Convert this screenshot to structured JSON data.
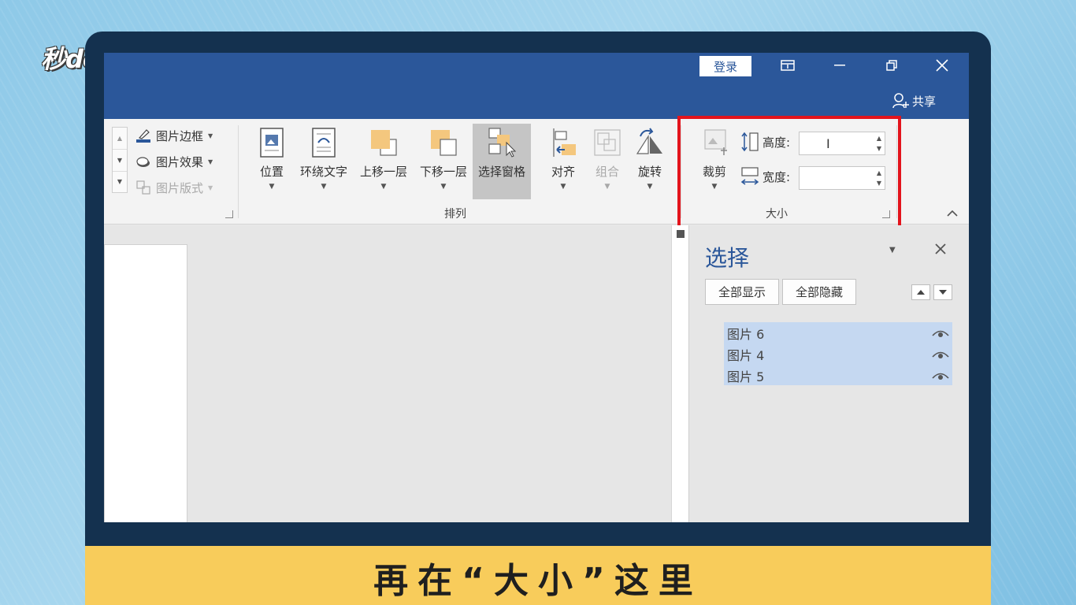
{
  "logo": "秒dòng视频",
  "caption": "再在“大小”这里",
  "window": {
    "login_label": "登录",
    "share_label": "共享"
  },
  "ribbon": {
    "picture_styles": {
      "border_label": "图片边框",
      "effects_label": "图片效果",
      "layout_label": "图片版式"
    },
    "arrange": {
      "group_label": "排列",
      "position_label": "位置",
      "wrap_text_label": "环绕文字",
      "bring_forward_label": "上移一层",
      "send_backward_label": "下移一层",
      "selection_pane_label": "选择窗格",
      "align_label": "对齐",
      "group_btn_label": "组合",
      "rotate_label": "旋转"
    },
    "size": {
      "group_label": "大小",
      "crop_label": "裁剪",
      "height_label": "高度:",
      "width_label": "宽度:",
      "height_value": "",
      "width_value": ""
    }
  },
  "selection_pane": {
    "title": "选择",
    "show_all_label": "全部显示",
    "hide_all_label": "全部隐藏",
    "items": [
      {
        "label": "图片 6"
      },
      {
        "label": "图片 4"
      },
      {
        "label": "图片 5"
      }
    ]
  },
  "colors": {
    "word_blue": "#2b579a",
    "highlight_red": "#e3141c",
    "caption_yellow": "#f8cc5b",
    "selected_row": "#c5d8f1"
  }
}
